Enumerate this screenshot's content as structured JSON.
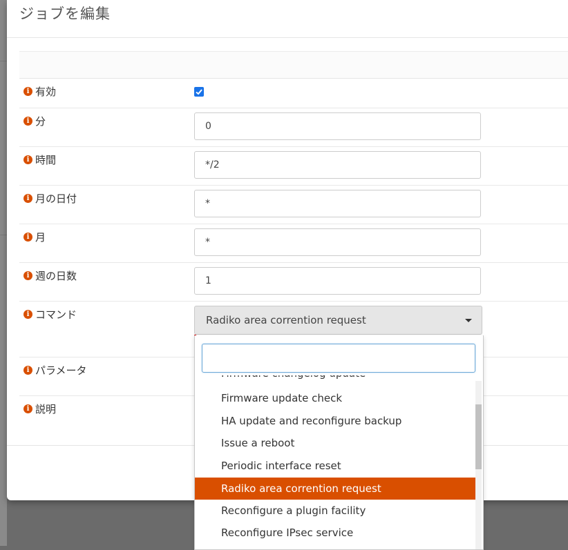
{
  "modal": {
    "title": "ジョブを編集"
  },
  "fields": {
    "enabled": {
      "label": "有効",
      "checked": true
    },
    "minute": {
      "label": "分",
      "value": "0"
    },
    "hour": {
      "label": "時間",
      "value": "*/2"
    },
    "day_of_month": {
      "label": "月の日付",
      "value": "*"
    },
    "month": {
      "label": "月",
      "value": "*"
    },
    "day_of_week": {
      "label": "週の日数",
      "value": "1"
    },
    "command": {
      "label": "コマンド",
      "value": "Radiko area corrention request"
    },
    "parameters": {
      "label": "パラメータ"
    },
    "description": {
      "label": "説明"
    }
  },
  "dropdown": {
    "search_value": "",
    "items": [
      "Firmware changelog update",
      "Firmware update check",
      "HA update and reconfigure backup",
      "Issue a reboot",
      "Periodic interface reset",
      "Radiko area corrention request",
      "Reconfigure a plugin facility",
      "Reconfigure IPsec service"
    ],
    "selected_index": 5
  },
  "colors": {
    "accent": "#d94f00",
    "checkbox": "#1a73e8"
  },
  "icons": {
    "info": "info-icon",
    "caret": "caret-down-icon"
  }
}
